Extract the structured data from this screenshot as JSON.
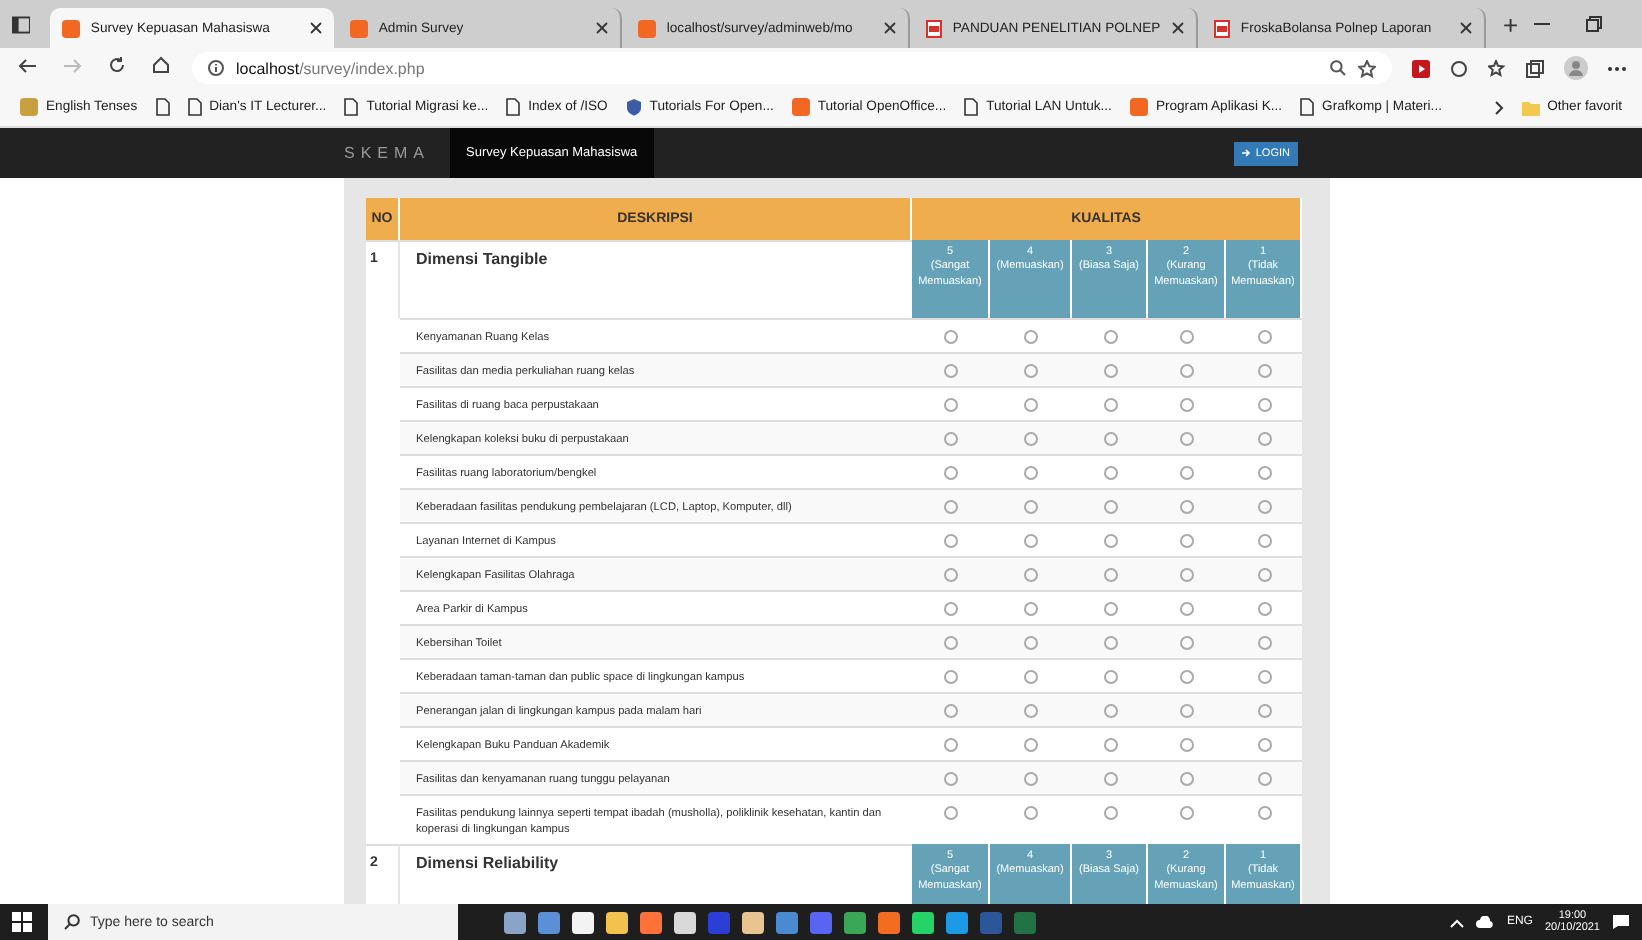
{
  "browser": {
    "tabs": [
      {
        "title": "Survey Kepuasan Mahasiswa",
        "kind": "orange",
        "selected": true
      },
      {
        "title": "Admin Survey",
        "kind": "orange",
        "selected": false
      },
      {
        "title": "localhost/survey/adminweb/mo",
        "kind": "orange",
        "selected": false
      },
      {
        "title": "PANDUAN PENELITIAN POLNEP",
        "kind": "pdf",
        "selected": false
      },
      {
        "title": "FroskaBolansa Polnep Laporan",
        "kind": "pdf",
        "selected": false
      }
    ],
    "new_tab": "+",
    "address": {
      "host": "localhost",
      "path": "/survey/index.php"
    },
    "bookmarks": [
      {
        "label": "English Tenses",
        "kind": "flag"
      },
      {
        "kind": "page"
      },
      {
        "label": "Dian's IT Lecturer...",
        "kind": "page"
      },
      {
        "label": "Tutorial Migrasi ke...",
        "kind": "page"
      },
      {
        "label": "Index of /ISO",
        "kind": "page"
      },
      {
        "label": "Tutorials For Open...",
        "kind": "shield"
      },
      {
        "label": "Tutorial OpenOffice...",
        "kind": "orange"
      },
      {
        "label": "Tutorial LAN Untuk...",
        "kind": "page"
      },
      {
        "label": "Program Aplikasi K...",
        "kind": "orange"
      },
      {
        "label": "Grafkomp | Materi...",
        "kind": "page"
      }
    ],
    "other_favorites": "Other favorit"
  },
  "navbar": {
    "brand": "SKEMA",
    "items": [
      {
        "label": "Survey Kepuasan Mahasiswa",
        "selected": true
      }
    ],
    "login": "LOGIN"
  },
  "table": {
    "columns": [
      "NO",
      "DESKRIPSI",
      "KUALITAS"
    ],
    "sections": [
      {
        "no": "1",
        "title": "Dimensi Tangible",
        "ratings": [
          {
            "value": "5",
            "label": "(Sangat Memuaskan)"
          },
          {
            "value": "4",
            "label": "(Memuaskan)"
          },
          {
            "value": "3",
            "label": "(Biasa Saja)"
          },
          {
            "value": "2",
            "label": "(Kurang Memuaskan)"
          },
          {
            "value": "1",
            "label": "(Tidak Memuaskan)"
          }
        ],
        "items": [
          {
            "text": "Kenyamanan Ruang Kelas",
            "checked": [
              false,
              false,
              false,
              false,
              false
            ]
          },
          {
            "text": "Fasilitas dan media perkuliahan ruang kelas",
            "checked": [
              false,
              false,
              false,
              false,
              false
            ]
          },
          {
            "text": "Fasilitas di ruang baca perpustakaan",
            "checked": [
              false,
              false,
              false,
              false,
              false
            ]
          },
          {
            "text": "Kelengkapan koleksi buku di perpustakaan",
            "checked": [
              false,
              false,
              false,
              false,
              false
            ]
          },
          {
            "text": "Fasilitas ruang laboratorium/bengkel",
            "checked": [
              false,
              false,
              false,
              false,
              false
            ]
          },
          {
            "text": "Keberadaan fasilitas pendukung pembelajaran (LCD, Laptop, Komputer, dll)",
            "checked": [
              false,
              false,
              false,
              false,
              false
            ]
          },
          {
            "text": "Layanan Internet di Kampus",
            "checked": [
              false,
              false,
              false,
              false,
              false
            ]
          },
          {
            "text": "Kelengkapan Fasilitas Olahraga",
            "checked": [
              false,
              false,
              false,
              false,
              false
            ]
          },
          {
            "text": "Area Parkir di Kampus",
            "checked": [
              false,
              false,
              false,
              false,
              false
            ]
          },
          {
            "text": "Kebersihan Toilet",
            "checked": [
              false,
              false,
              false,
              false,
              false
            ]
          },
          {
            "text": "Keberadaan taman-taman dan public space di lingkungan kampus",
            "checked": [
              false,
              false,
              false,
              false,
              false
            ]
          },
          {
            "text": "Penerangan jalan di lingkungan kampus pada malam hari",
            "checked": [
              false,
              false,
              false,
              false,
              false
            ]
          },
          {
            "text": "Kelengkapan Buku Panduan Akademik",
            "checked": [
              false,
              false,
              false,
              false,
              false
            ]
          },
          {
            "text": "Fasilitas dan kenyamanan ruang tunggu pelayanan",
            "checked": [
              false,
              false,
              false,
              false,
              false
            ]
          },
          {
            "text": "Fasilitas pendukung lainnya seperti tempat ibadah (musholla), poliklinik kesehatan, kantin dan koperasi di lingkungan kampus",
            "checked": [
              false,
              false,
              false,
              false,
              false
            ]
          }
        ]
      },
      {
        "no": "2",
        "title": "Dimensi Reliability",
        "ratings": [
          {
            "value": "5",
            "label": "(Sangat Memuaskan)"
          },
          {
            "value": "4",
            "label": "(Memuaskan)"
          },
          {
            "value": "3",
            "label": "(Biasa Saja)"
          },
          {
            "value": "2",
            "label": "(Kurang Memuaskan)"
          },
          {
            "value": "1",
            "label": "(Tidak Memuaskan)"
          }
        ]
      }
    ]
  },
  "taskbar": {
    "search_placeholder": "Type here to search",
    "language": "ENG",
    "time": "19:00",
    "date": "20/10/2021"
  }
}
